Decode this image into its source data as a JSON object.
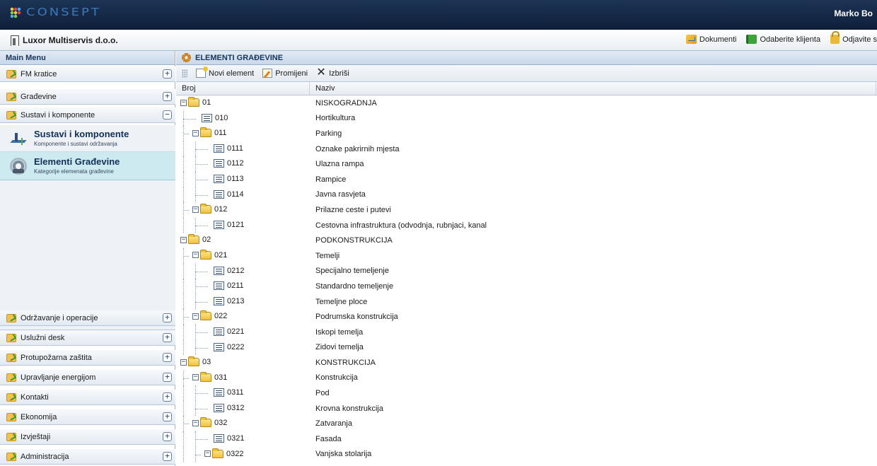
{
  "app": {
    "logo_text": "CONSEPT",
    "user_name": "Marko Bo"
  },
  "header": {
    "company": "Luxor Multiservis d.o.o.",
    "actions": [
      "Dokumenti",
      "Odaberite klijenta",
      "Odjavite s"
    ]
  },
  "sidebar": {
    "title": "Main Menu",
    "sections": [
      {
        "label": "FM kratice",
        "state": "+"
      },
      {
        "label": "Građevine",
        "state": "+"
      },
      {
        "label": "Sustavi i komponente",
        "state": "−"
      },
      {
        "label": "Održavanje i operacije",
        "state": "+"
      },
      {
        "label": "Uslužni desk",
        "state": "+"
      },
      {
        "label": "Protupožarna zaštita",
        "state": "+"
      },
      {
        "label": "Upravljanje energijom",
        "state": "+"
      },
      {
        "label": "Kontakti",
        "state": "+"
      },
      {
        "label": "Ekonomija",
        "state": "+"
      },
      {
        "label": "Izvještaji",
        "state": "+"
      },
      {
        "label": "Administracija",
        "state": "+"
      }
    ],
    "sub_items": [
      {
        "title": "Sustavi i komponente",
        "desc": "Komponente i sustavi održavanja"
      },
      {
        "title": "Elementi Građevine",
        "desc": "Kategorije elemenata građevine"
      }
    ]
  },
  "main": {
    "title": "ELEMENTI GRAĐEVINE",
    "toolbar": {
      "new_label": "Novi element",
      "edit_label": "Promijeni",
      "delete_label": "Izbriši"
    },
    "columns": [
      "Broj",
      "Naziv"
    ],
    "rows": [
      {
        "broj": "01",
        "naziv": "NISKOGRADNJA",
        "level": 0,
        "type": "folder"
      },
      {
        "broj": "010",
        "naziv": "Hortikultura",
        "level": 1,
        "type": "leaf"
      },
      {
        "broj": "011",
        "naziv": "Parking",
        "level": 1,
        "type": "folder"
      },
      {
        "broj": "0111",
        "naziv": "Oznake pakrirnih mjesta",
        "level": 2,
        "type": "leaf"
      },
      {
        "broj": "0112",
        "naziv": "Ulazna rampa",
        "level": 2,
        "type": "leaf"
      },
      {
        "broj": "0113",
        "naziv": "Rampice",
        "level": 2,
        "type": "leaf"
      },
      {
        "broj": "0114",
        "naziv": "Javna rasvjeta",
        "level": 2,
        "type": "leaf"
      },
      {
        "broj": "012",
        "naziv": "Prilazne ceste i putevi",
        "level": 1,
        "type": "folder"
      },
      {
        "broj": "0121",
        "naziv": "Cestovna infrastruktura (odvodnja, rubnjaci, kanal",
        "level": 2,
        "type": "leaf"
      },
      {
        "broj": "02",
        "naziv": "PODKONSTRUKCIJA",
        "level": 0,
        "type": "folder"
      },
      {
        "broj": "021",
        "naziv": "Temelji",
        "level": 1,
        "type": "folder"
      },
      {
        "broj": "0212",
        "naziv": "Specijalno temeljenje",
        "level": 2,
        "type": "leaf"
      },
      {
        "broj": "0211",
        "naziv": "Standardno temeljenje",
        "level": 2,
        "type": "leaf"
      },
      {
        "broj": "0213",
        "naziv": "Temeljne ploce",
        "level": 2,
        "type": "leaf"
      },
      {
        "broj": "022",
        "naziv": "Podrumska konstrukcija",
        "level": 1,
        "type": "folder"
      },
      {
        "broj": "0221",
        "naziv": "Iskopi temelja",
        "level": 2,
        "type": "leaf"
      },
      {
        "broj": "0222",
        "naziv": "Zidovi temelja",
        "level": 2,
        "type": "leaf"
      },
      {
        "broj": "03",
        "naziv": "KONSTRUKCIJA",
        "level": 0,
        "type": "folder"
      },
      {
        "broj": "031",
        "naziv": "Konstrukcija",
        "level": 1,
        "type": "folder"
      },
      {
        "broj": "0311",
        "naziv": "Pod",
        "level": 2,
        "type": "leaf"
      },
      {
        "broj": "0312",
        "naziv": "Krovna konstrukcija",
        "level": 2,
        "type": "leaf"
      },
      {
        "broj": "032",
        "naziv": "Zatvaranja",
        "level": 1,
        "type": "folder"
      },
      {
        "broj": "0321",
        "naziv": "Fasada",
        "level": 2,
        "type": "leaf"
      },
      {
        "broj": "0322",
        "naziv": "Vanjska stolarija",
        "level": 2,
        "type": "folder"
      }
    ]
  },
  "icons": {
    "logo": "consept-logo-icon",
    "company": "building-icon",
    "documents": "folder-docs-icon",
    "client": "book-icon",
    "logout": "lock-icon",
    "section": "arrow-folder-icon",
    "sustavi": "network-icon",
    "elementi": "cog-icon",
    "panel": "gear-icon",
    "new": "new-document-icon",
    "edit": "edit-icon",
    "delete": "close-icon",
    "tree_folder": "folder-icon",
    "tree_leaf": "document-icon"
  },
  "colors": {
    "topbar": "#0e1f39",
    "logo": "#3d78b8",
    "active_item": "#cdeaf0",
    "panel_title": "#15355c"
  }
}
